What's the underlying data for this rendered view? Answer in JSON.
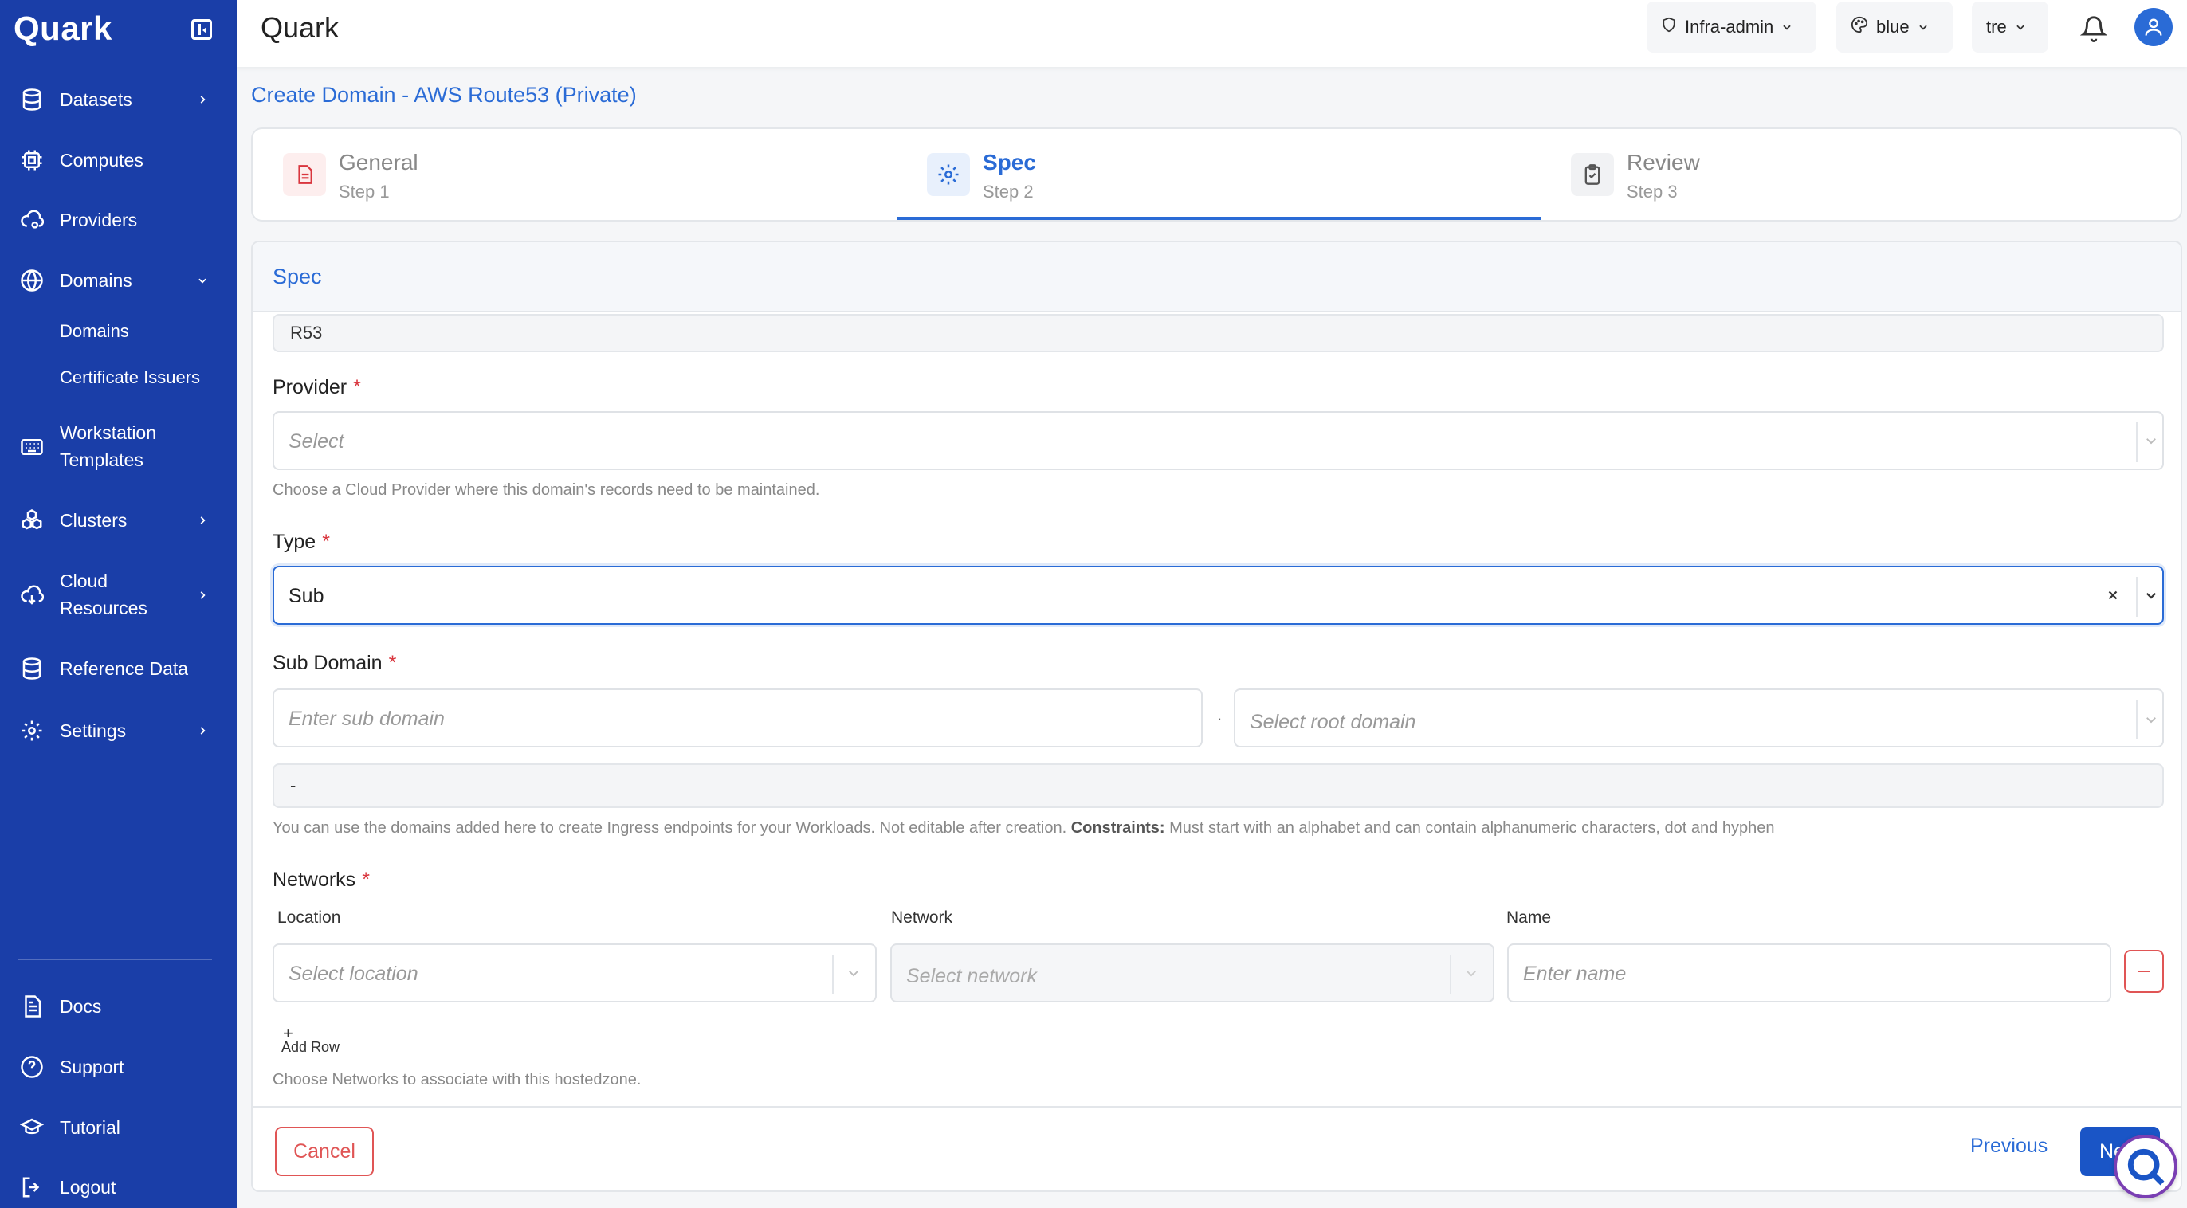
{
  "app": {
    "brand": "Quark",
    "page_header": "Quark"
  },
  "topbar": {
    "role": "Infra-admin",
    "theme": "blue",
    "tenant": "tre"
  },
  "sidebar": {
    "items": [
      {
        "label": "Datasets"
      },
      {
        "label": "Computes"
      },
      {
        "label": "Providers"
      },
      {
        "label": "Domains"
      },
      {
        "label": "Workstation Templates"
      },
      {
        "label": "Clusters"
      },
      {
        "label": "Cloud Resources"
      },
      {
        "label": "Reference Data"
      },
      {
        "label": "Settings"
      }
    ],
    "domains_sub": [
      "Domains",
      "Certificate Issuers"
    ],
    "bottom": [
      "Docs",
      "Support",
      "Tutorial",
      "Logout"
    ]
  },
  "page": {
    "title": "Create Domain - AWS Route53 (Private)"
  },
  "steps": [
    {
      "title": "General",
      "sub": "Step 1"
    },
    {
      "title": "Spec",
      "sub": "Step 2"
    },
    {
      "title": "Review",
      "sub": "Step 3"
    }
  ],
  "form": {
    "header": "Spec",
    "code_value": "R53",
    "provider": {
      "label": "Provider",
      "placeholder": "Select",
      "help": "Choose a Cloud Provider where this domain's records need to be maintained."
    },
    "type": {
      "label": "Type",
      "value": "Sub"
    },
    "sub_domain": {
      "label": "Sub Domain",
      "placeholder": "Enter sub domain",
      "separator": ".",
      "root_placeholder": "Select root domain",
      "preview": "-",
      "help_prefix": "You can use the domains added here to create Ingress endpoints for your Workloads. Not editable after creation.",
      "help_bold": "Constraints:",
      "help_suffix": "Must start with an alphabet and can contain alphanumeric characters, dot and hyphen"
    },
    "networks": {
      "label": "Networks",
      "col_location": "Location",
      "col_network": "Network",
      "col_name": "Name",
      "location_placeholder": "Select location",
      "network_placeholder": "Select network",
      "name_placeholder": "Enter name",
      "add_row": "Add Row",
      "help": "Choose Networks to associate with this hostedzone."
    }
  },
  "footer": {
    "cancel": "Cancel",
    "previous": "Previous",
    "next": "Next"
  },
  "colors": {
    "sidebar": "#1a3ea8",
    "accent": "#2a6bd6",
    "danger": "#e05555"
  }
}
